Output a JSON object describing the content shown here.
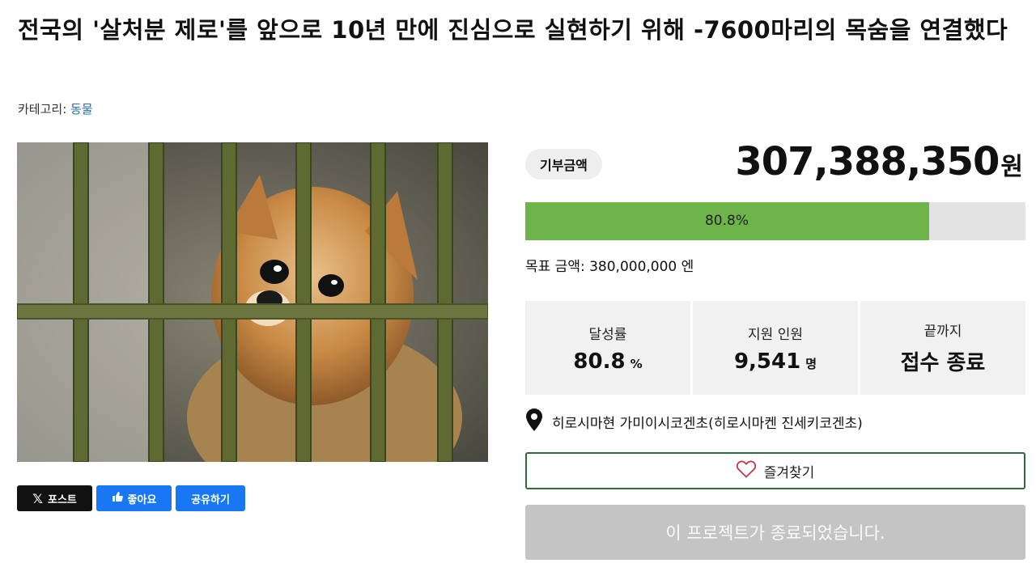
{
  "title": "전국의 '살처분 제로'를 앞으로 10년 만에 진심으로 실현하기 위해 -7600마리의 목숨을 연결했다",
  "category": {
    "label": "카테고리:",
    "value": "동물"
  },
  "photo": {
    "subject": "puppy-behind-cage-bars"
  },
  "share": {
    "x_label": "포스트",
    "like_label": "좋아요",
    "share_label": "공유하기"
  },
  "donation": {
    "pill_label": "기부금액",
    "amount": "307,388,350",
    "unit": "원",
    "progress_text": "80.8%",
    "progress_fraction": 0.808,
    "goal_text": "목표 금액: 380,000,000 엔"
  },
  "stats": [
    {
      "key": "달성률",
      "value": "80.8",
      "unit": "%"
    },
    {
      "key": "지원 인원",
      "value": "9,541",
      "unit": "명"
    },
    {
      "key": "끝까지",
      "value": "접수 종료",
      "unit": ""
    }
  ],
  "location": {
    "text": "히로시마현 가미이시코겐초(히로시마켄 진세키코겐초)"
  },
  "favorite": {
    "label": "즐겨찾기"
  },
  "ended": {
    "label": "이 프로젝트가 종료되었습니다."
  },
  "colors": {
    "progress": "#6db44a",
    "fav_border": "#2f6b3a",
    "link": "#2a6fb0",
    "facebook": "#1877f2"
  }
}
